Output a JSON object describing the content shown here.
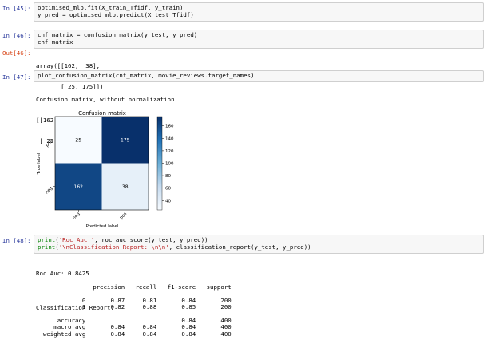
{
  "cells": [
    {
      "prompt": "In [45]:",
      "lines": [
        "optimised_mlp.fit(X_train_Tfidf, y_train)",
        "y_pred = optimised_mlp.predict(X_test_Tfidf)"
      ]
    },
    {
      "prompt": "In [46]:",
      "lines": [
        "cnf_matrix = confusion_matrix(y_test, y_pred)",
        "cnf_matrix"
      ],
      "out_prompt": "Out[46]:",
      "output_lines": [
        "array([[162,  38],",
        "       [ 25, 175]])"
      ]
    },
    {
      "prompt": "In [47]:",
      "lines": [
        "plot_confusion_matrix(cnf_matrix, movie_reviews.target_names)"
      ],
      "output_lines": [
        "Confusion matrix, without normalization",
        "[[162  38]",
        " [ 25 175]]"
      ]
    },
    {
      "prompt": "In [48]:",
      "line1": {
        "func": "print",
        "open": "(",
        "str": "'Roc Auc:'",
        "rest": ", roc_auc_score(y_test, y_pred))"
      },
      "line2": {
        "func": "print",
        "open": "(",
        "str": "'\\nClassification Report: \\n\\n'",
        "rest": ", classification_report(y_test, y_pred))"
      },
      "output_lines": [
        "Roc Auc: 0.8425",
        "",
        "Classification Report:"
      ]
    }
  ],
  "report": {
    "header": [
      "",
      "precision",
      "recall",
      "f1-score",
      "support"
    ],
    "rows": [
      [
        "0",
        "0.87",
        "0.81",
        "0.84",
        "200"
      ],
      [
        "1",
        "0.82",
        "0.88",
        "0.85",
        "200"
      ],
      [
        "",
        "",
        "",
        "",
        ""
      ],
      [
        "accuracy",
        "",
        "",
        "0.84",
        "400"
      ],
      [
        "macro avg",
        "0.84",
        "0.84",
        "0.84",
        "400"
      ],
      [
        "weighted avg",
        "0.84",
        "0.84",
        "0.84",
        "400"
      ]
    ]
  },
  "chart_data": {
    "type": "heatmap",
    "title": "Confusion matrix",
    "xlabel": "Predicted label",
    "ylabel": "True label",
    "x_tick_labels": [
      "neg",
      "pos"
    ],
    "y_tick_labels": [
      "pos",
      "neg"
    ],
    "values": [
      [
        25,
        175
      ],
      [
        162,
        38
      ]
    ],
    "colorbar_ticks": [
      40,
      60,
      80,
      100,
      120,
      140,
      160
    ],
    "colorbar_range": [
      25,
      175
    ],
    "colormap": "Blues"
  },
  "colors": {
    "in_prompt": "#303f9f",
    "out_prompt": "#d84315",
    "keyword": "#008000",
    "string": "#ba2121"
  }
}
